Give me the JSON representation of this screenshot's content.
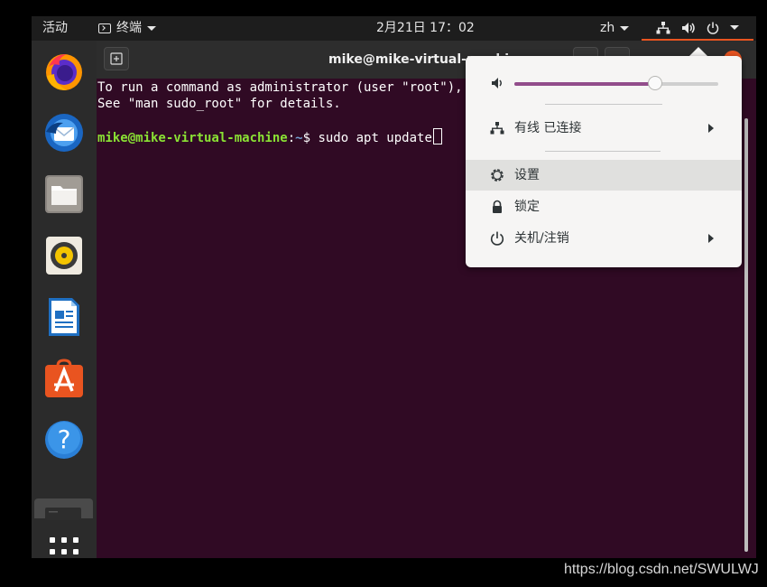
{
  "topbar": {
    "activities": "活动",
    "app_menu": "终端",
    "clock": "2月21日  17：02",
    "language": "zh"
  },
  "dock": {
    "apps": [
      "firefox-icon",
      "thunderbird-icon",
      "files-icon",
      "rhythmbox-icon",
      "libreoffice-writer-icon",
      "ubuntu-software-icon",
      "help-icon",
      "terminal-icon"
    ]
  },
  "terminal": {
    "title": "mike@mike-virtual-machine: ~",
    "line1": "To run a command as administrator (user \"root\"), use \"sudo <command>\".",
    "line2": "See \"man sudo_root\" for details.",
    "prompt_user": "mike@mike-virtual-machine",
    "prompt_colon": ":",
    "prompt_path": "~",
    "prompt_symbol": "$ ",
    "command": "sudo apt update"
  },
  "system_menu": {
    "volume_percent": 69,
    "wired": "有线 已连接",
    "settings": "设置",
    "lock": "锁定",
    "power": "关机/注销"
  },
  "watermark": "https://blog.csdn.net/SWULWJ",
  "colors": {
    "accent": "#e95420",
    "terminal_bg": "#300a24",
    "slider_fill": "#924d8b"
  }
}
